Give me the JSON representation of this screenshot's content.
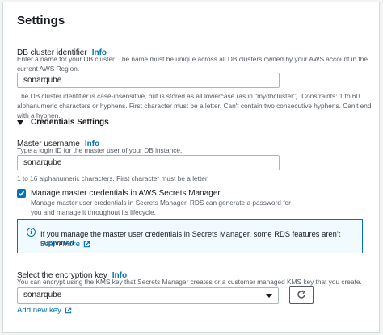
{
  "header": {
    "title": "Settings"
  },
  "db_cluster_identifier": {
    "label": "DB cluster identifier",
    "info": "Info",
    "description": "Enter a name for your DB cluster. The name must be unique across all DB clusters owned by your AWS account in the current AWS Region.",
    "value": "sonarqube",
    "constraints": "The DB cluster identifier is case-insensitive, but is stored as all lowercase (as in \"mydbcluster\"). Constraints: 1 to 60 alphanumeric characters or hyphens. First character must be a letter. Can't contain two consecutive hyphens. Can't end with a hyphen."
  },
  "credentials": {
    "section_title": "Credentials Settings",
    "master_username": {
      "label": "Master username",
      "info": "Info",
      "description": "Type a login ID for the master user of your DB instance.",
      "value": "sonarqube",
      "constraints": "1 to 16 alphanumeric characters. First character must be a letter."
    },
    "manage_secrets": {
      "label": "Manage master credentials in AWS Secrets Manager",
      "description": "Manage master user credentials in Secrets Manager. RDS can generate a password for you and manage it throughout its lifecycle.",
      "checked": true
    },
    "alert": {
      "text": "If you manage the master user credentials in Secrets Manager, some RDS features aren't supported.",
      "link": "Learn more"
    }
  },
  "encryption_key": {
    "label": "Select the encryption key",
    "info": "Info",
    "description": "You can encrypt using the KMS key that Secrets Manager creates or a customer managed KMS key that you create.",
    "selected": "sonarqube",
    "add_link": "Add new key"
  },
  "colors": {
    "link": "#0073bb",
    "border": "#aab7b8",
    "alert_bg": "#f1faff"
  }
}
